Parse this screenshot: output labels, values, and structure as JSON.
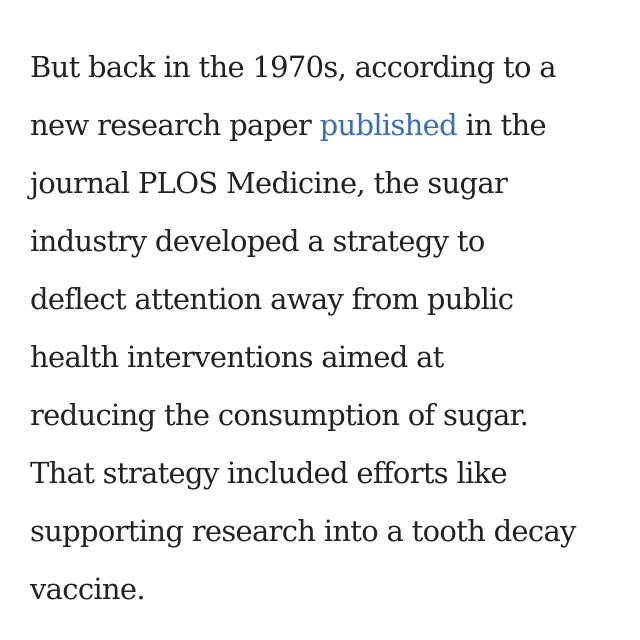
{
  "article": {
    "lines": [
      {
        "before": "But back in the 1970s, according to a"
      },
      {
        "before": "new research paper ",
        "link": "published",
        "after": " in the"
      },
      {
        "before": "journal PLOS Medicine, the sugar"
      },
      {
        "before": "industry developed a strategy to"
      },
      {
        "before": "deflect attention away from public"
      },
      {
        "before": "health interventions aimed at"
      },
      {
        "before": "reducing the consumption of sugar."
      },
      {
        "before": "That strategy included efforts like"
      },
      {
        "before": "supporting research into a tooth decay"
      },
      {
        "before": "vaccine."
      }
    ],
    "link_color": "#3b6db4",
    "text_color": "#222222"
  }
}
